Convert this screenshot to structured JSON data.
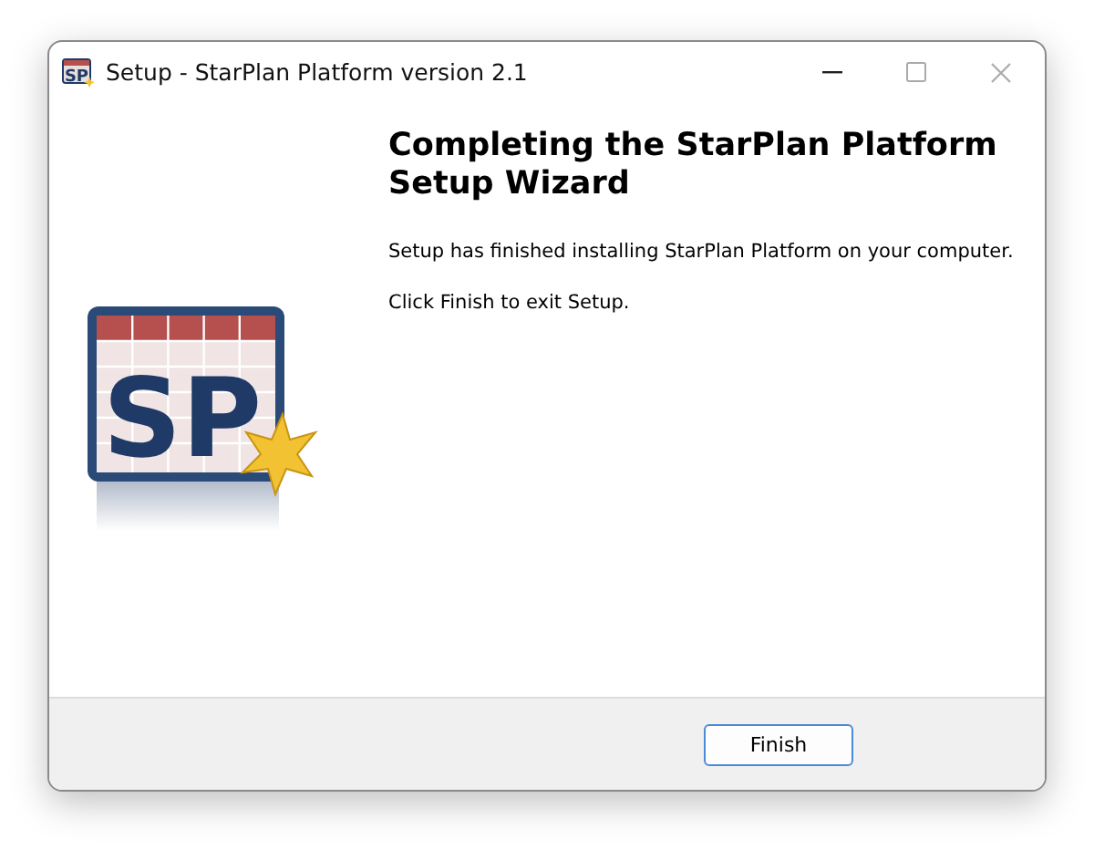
{
  "window": {
    "title": "Setup - StarPlan Platform version 2.1",
    "app_icon_text": "SP"
  },
  "logo": {
    "text": "SP"
  },
  "heading": "Completing the StarPlan Platform Setup Wizard",
  "paragraphs": [
    "Setup has finished installing StarPlan Platform on your computer.",
    "Click Finish to exit Setup."
  ],
  "buttons": [
    "Finish"
  ]
}
